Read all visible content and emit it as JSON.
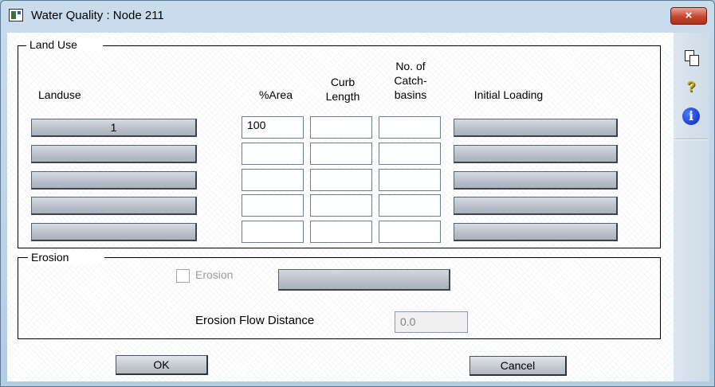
{
  "window": {
    "title": "Water Quality : Node 211",
    "close_label": "×"
  },
  "toolbar": {
    "help_glyph": "?",
    "info_glyph": "i"
  },
  "land_use": {
    "group_title": "Land Use",
    "headers": {
      "landuse": "Landuse",
      "area": "%Area",
      "curb_length": "Curb\nLength",
      "catch_basins": "No. of\nCatch-\nbasins",
      "initial_loading": "Initial Loading"
    },
    "rows": [
      {
        "landuse": "1",
        "area": "100",
        "curb_length": "",
        "catch_basins": "",
        "initial_loading": ""
      },
      {
        "landuse": "",
        "area": "",
        "curb_length": "",
        "catch_basins": "",
        "initial_loading": ""
      },
      {
        "landuse": "",
        "area": "",
        "curb_length": "",
        "catch_basins": "",
        "initial_loading": ""
      },
      {
        "landuse": "",
        "area": "",
        "curb_length": "",
        "catch_basins": "",
        "initial_loading": ""
      },
      {
        "landuse": "",
        "area": "",
        "curb_length": "",
        "catch_basins": "",
        "initial_loading": ""
      }
    ]
  },
  "erosion": {
    "group_title": "Erosion",
    "checkbox_label": "Erosion",
    "checkbox_checked": false,
    "button_label": "",
    "flow_distance_label": "Erosion Flow Distance",
    "flow_distance_value": "0.0"
  },
  "buttons": {
    "ok": "OK",
    "cancel": "Cancel"
  }
}
